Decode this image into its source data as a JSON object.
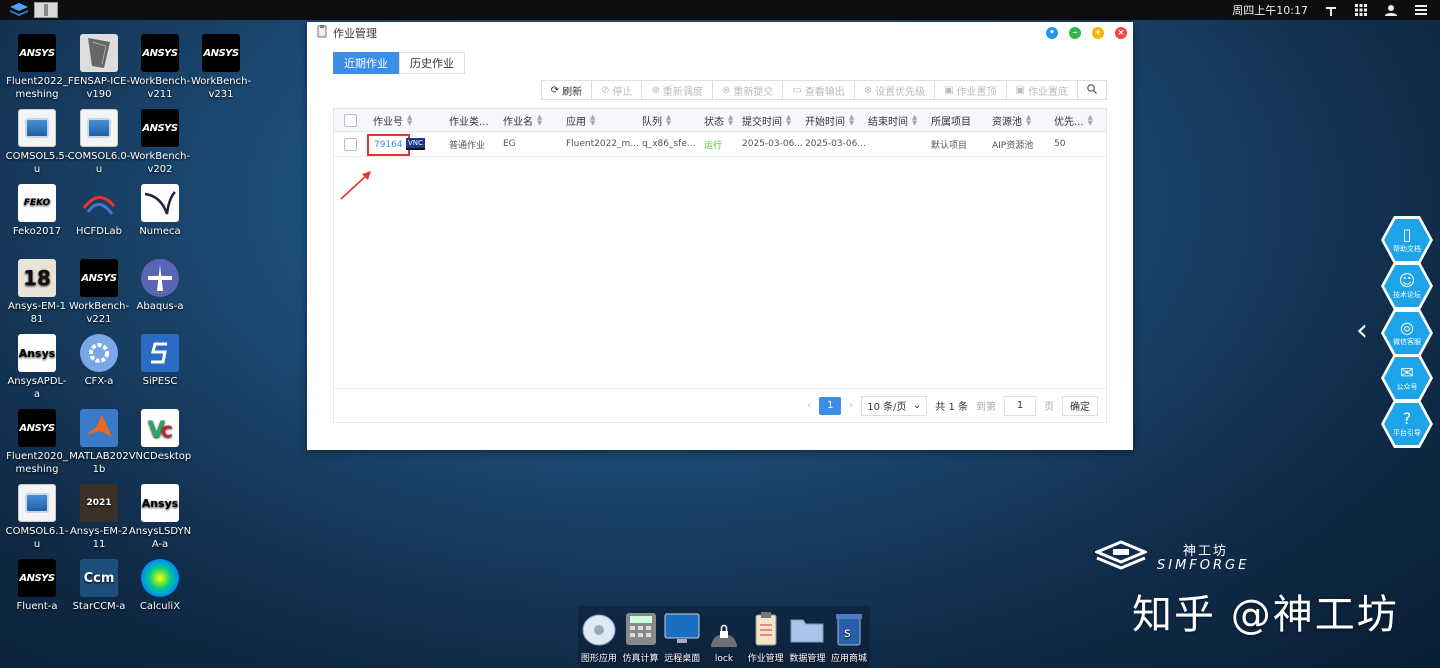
{
  "taskbar": {
    "clock": "周四上午10:17"
  },
  "desktop_icons": [
    {
      "label": "Fluent2022_meshing",
      "badge": "ANSYS",
      "style": "ansys"
    },
    {
      "label": "FENSAP-ICE-v190",
      "badge": "",
      "style": "fensap"
    },
    {
      "label": "WorkBench-v211",
      "badge": "ANSYS",
      "style": "ansys"
    },
    {
      "label": "WorkBench-v231",
      "badge": "ANSYS",
      "style": "ansys"
    },
    {
      "label": "COMSOL5.5-u",
      "badge": "",
      "style": "comsol"
    },
    {
      "label": "COMSOL6.0-u",
      "badge": "",
      "style": "comsol"
    },
    {
      "label": "WorkBench-v202",
      "badge": "ANSYS",
      "style": "ansys"
    },
    {
      "label": "Feko2017",
      "badge": "FEKO",
      "style": "feko"
    },
    {
      "label": "HCFDLab",
      "badge": "",
      "style": "hcfd"
    },
    {
      "label": "Numeca",
      "badge": "",
      "style": "numeca"
    },
    {
      "label": "Ansys-EM-181",
      "badge": "18",
      "style": "em18"
    },
    {
      "label": "WorkBench-v221",
      "badge": "ANSYS",
      "style": "ansys"
    },
    {
      "label": "Abaqus-a",
      "badge": "",
      "style": "abaqus"
    },
    {
      "label": "AnsysAPDL-a",
      "badge": "Ansys",
      "style": "apdl"
    },
    {
      "label": "CFX-a",
      "badge": "",
      "style": "cfx"
    },
    {
      "label": "SiPESC",
      "badge": "",
      "style": "sipesc"
    },
    {
      "label": "Fluent2020_meshing",
      "badge": "ANSYS",
      "style": "ansys"
    },
    {
      "label": "MATLAB2021b",
      "badge": "",
      "style": "matlab"
    },
    {
      "label": "VNCDesktop",
      "badge": "",
      "style": "vnc"
    },
    {
      "label": "COMSOL6.1-u",
      "badge": "",
      "style": "comsol"
    },
    {
      "label": "Ansys-EM-211",
      "badge": "2021",
      "style": "em21"
    },
    {
      "label": "AnsysLSDYNA-a",
      "badge": "Ansys",
      "style": "dyna"
    },
    {
      "label": "Fluent-a",
      "badge": "ANSYS",
      "style": "ansys"
    },
    {
      "label": "StarCCM-a",
      "badge": "Ccm",
      "style": "starccm"
    },
    {
      "label": "CalculiX",
      "badge": "",
      "style": "calculix"
    }
  ],
  "window": {
    "title": "作业管理",
    "tabs": [
      {
        "label": "近期作业",
        "active": true
      },
      {
        "label": "历史作业",
        "active": false
      }
    ],
    "toolbar": [
      {
        "label": "刷新",
        "enabled": true
      },
      {
        "label": "停止",
        "enabled": false
      },
      {
        "label": "重新调度",
        "enabled": false
      },
      {
        "label": "重新提交",
        "enabled": false
      },
      {
        "label": "查看输出",
        "enabled": false
      },
      {
        "label": "设置优先级",
        "enabled": false
      },
      {
        "label": "作业置顶",
        "enabled": false
      },
      {
        "label": "作业置底",
        "enabled": false
      }
    ],
    "columns": [
      "作业号",
      "作业类...",
      "作业名",
      "应用",
      "队列",
      "状态",
      "提交时间",
      "开始时间",
      "结束时间",
      "所属项目",
      "资源池",
      "优先..."
    ],
    "rows": [
      {
        "job_id": "79164",
        "vnc": "VNC",
        "type": "普通作业",
        "name": "EG",
        "app": "Fluent2022_m...",
        "queue": "q_x86_sfe...",
        "status": "运行",
        "submit": "2025-03-06...",
        "start": "2025-03-06...",
        "end": "",
        "project": "默认项目",
        "pool": "AIP资源池",
        "priority": "50"
      }
    ],
    "pager": {
      "page": "1",
      "page_size": "10 条/页",
      "total": "共 1 条",
      "goto_label": "到第",
      "goto_value": "1",
      "page_unit": "页",
      "confirm": "确定"
    },
    "status_color": "#52c41a",
    "accent": "#3a8ee6"
  },
  "dock": [
    {
      "label": "图形应用"
    },
    {
      "label": "仿真计算"
    },
    {
      "label": "远程桌面"
    },
    {
      "label": "lock"
    },
    {
      "label": "作业管理"
    },
    {
      "label": "数据管理"
    },
    {
      "label": "应用商城"
    }
  ],
  "side_panel": [
    "帮助文档",
    "技术论坛",
    "微信客服",
    "公众号",
    "平台引导"
  ],
  "brand": {
    "cn": "神工坊",
    "en": "SIMFORGE"
  },
  "watermark": "知乎 @神工坊"
}
